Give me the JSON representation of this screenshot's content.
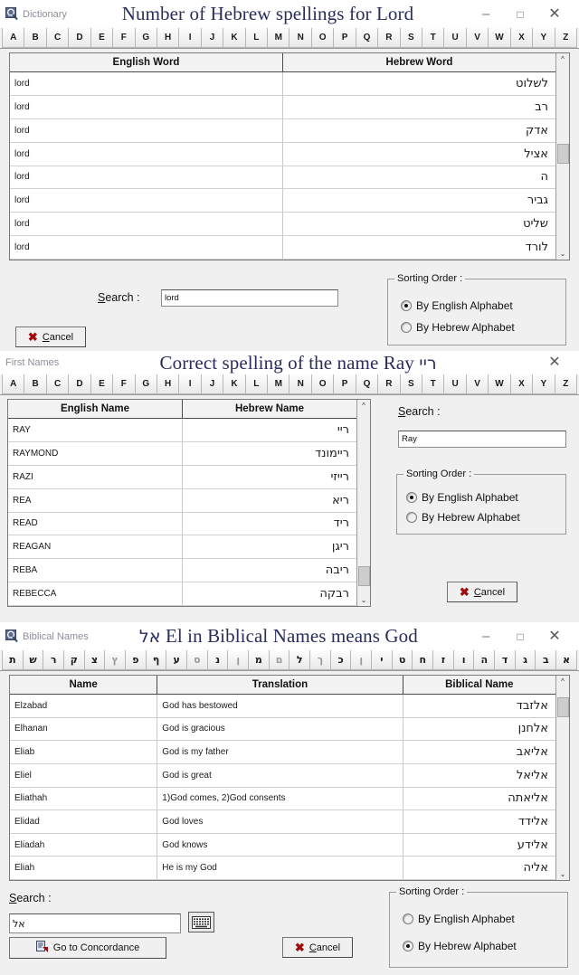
{
  "window1": {
    "app_label": "Dictionary",
    "app_icon": "magnifier-icon",
    "title": "Number of Hebrew spellings for Lord",
    "controls": {
      "minimize": "–",
      "maximize": "□",
      "close": "✕"
    },
    "alphabet": [
      "A",
      "B",
      "C",
      "D",
      "E",
      "F",
      "G",
      "H",
      "I",
      "J",
      "K",
      "L",
      "M",
      "N",
      "O",
      "P",
      "Q",
      "R",
      "S",
      "T",
      "U",
      "V",
      "W",
      "X",
      "Y",
      "Z"
    ],
    "table": {
      "headers": [
        "English Word",
        "Hebrew Word"
      ],
      "rows": [
        [
          "lord",
          "לשלוט"
        ],
        [
          "lord",
          "רב"
        ],
        [
          "lord",
          "אדק"
        ],
        [
          "lord",
          "אציל"
        ],
        [
          "lord",
          "ה"
        ],
        [
          "lord",
          "גביר"
        ],
        [
          "lord",
          "שליט"
        ],
        [
          "lord",
          "לורד"
        ]
      ]
    },
    "search_label": "Search :",
    "search_value": "lord",
    "sorting_title": "Sorting Order :",
    "sort_options": [
      {
        "label": "By English Alphabet",
        "selected": true
      },
      {
        "label": "By Hebrew Alphabet",
        "selected": false
      }
    ],
    "cancel_label": "Cancel"
  },
  "window2": {
    "app_label": "First Names",
    "title": "Correct spelling of the name Ray",
    "title_hebrew": "ריי",
    "controls": {
      "close": "✕"
    },
    "alphabet": [
      "A",
      "B",
      "C",
      "D",
      "E",
      "F",
      "G",
      "H",
      "I",
      "J",
      "K",
      "L",
      "M",
      "N",
      "O",
      "P",
      "Q",
      "R",
      "S",
      "T",
      "U",
      "V",
      "W",
      "X",
      "Y",
      "Z"
    ],
    "table": {
      "headers": [
        "English Name",
        "Hebrew Name"
      ],
      "rows": [
        [
          "RAY",
          "ריי"
        ],
        [
          "RAYMOND",
          "ריימונד"
        ],
        [
          "RAZI",
          "רייזי"
        ],
        [
          "REA",
          "ריא"
        ],
        [
          "READ",
          "ריד"
        ],
        [
          "REAGAN",
          "ריגן"
        ],
        [
          "REBA",
          "ריבה"
        ],
        [
          "REBECCA",
          "רבקה"
        ]
      ]
    },
    "search_label": "Search :",
    "search_value": "Ray",
    "sorting_title": "Sorting Order :",
    "sort_options": [
      {
        "label": "By English Alphabet",
        "selected": true
      },
      {
        "label": "By Hebrew Alphabet",
        "selected": false
      }
    ],
    "cancel_label": "Cancel"
  },
  "window3": {
    "app_label": "Biblical Names",
    "app_icon": "magnifier-icon",
    "title_hebrew": "אל",
    "title": "El in Biblical Names means God",
    "controls": {
      "minimize": "–",
      "maximize": "□",
      "close": "✕"
    },
    "alphabet": [
      "ת",
      "ש",
      "ר",
      "ק",
      "צ",
      "ץ",
      "פ",
      "ף",
      "ע",
      "ס",
      "נ",
      "ן",
      "מ",
      "ם",
      "ל",
      "ך",
      "כ",
      "ן",
      "י",
      "ט",
      "ח",
      "ז",
      "ו",
      "ה",
      "ד",
      "ג",
      "ב",
      "א"
    ],
    "alphabet_dim": [
      5,
      9,
      11,
      13,
      15,
      17
    ],
    "table": {
      "headers": [
        "Name",
        "Translation",
        "Biblical Name"
      ],
      "rows": [
        [
          "Elzabad",
          "God has bestowed",
          "אלזבד"
        ],
        [
          "Elhanan",
          "God is gracious",
          "אלחנן"
        ],
        [
          "Eliab",
          "God is my father",
          "אליאב"
        ],
        [
          "Eliel",
          "God is great",
          "אליאל"
        ],
        [
          "Eliathah",
          "1)God comes, 2)God consents",
          "אליאתה"
        ],
        [
          "Elidad",
          "God loves",
          "אלידד"
        ],
        [
          "Eliadah",
          "God knows",
          "אלידע"
        ],
        [
          "Eliah",
          "He is my God",
          "אליה"
        ]
      ]
    },
    "search_label": "Search :",
    "search_value": "אל",
    "keyboard_icon": "keyboard-icon",
    "concordance_label": "Go to Concordance",
    "sorting_title": "Sorting Order :",
    "sort_options": [
      {
        "label": "By English Alphabet",
        "selected": false
      },
      {
        "label": "By Hebrew Alphabet",
        "selected": true
      }
    ],
    "cancel_label": "Cancel"
  },
  "colors": {
    "title_text": "#2a2d5c",
    "app_label": "#8a8f98",
    "window_bg": "#f0f0f0",
    "cancel_mark": "#9e0b0b"
  }
}
